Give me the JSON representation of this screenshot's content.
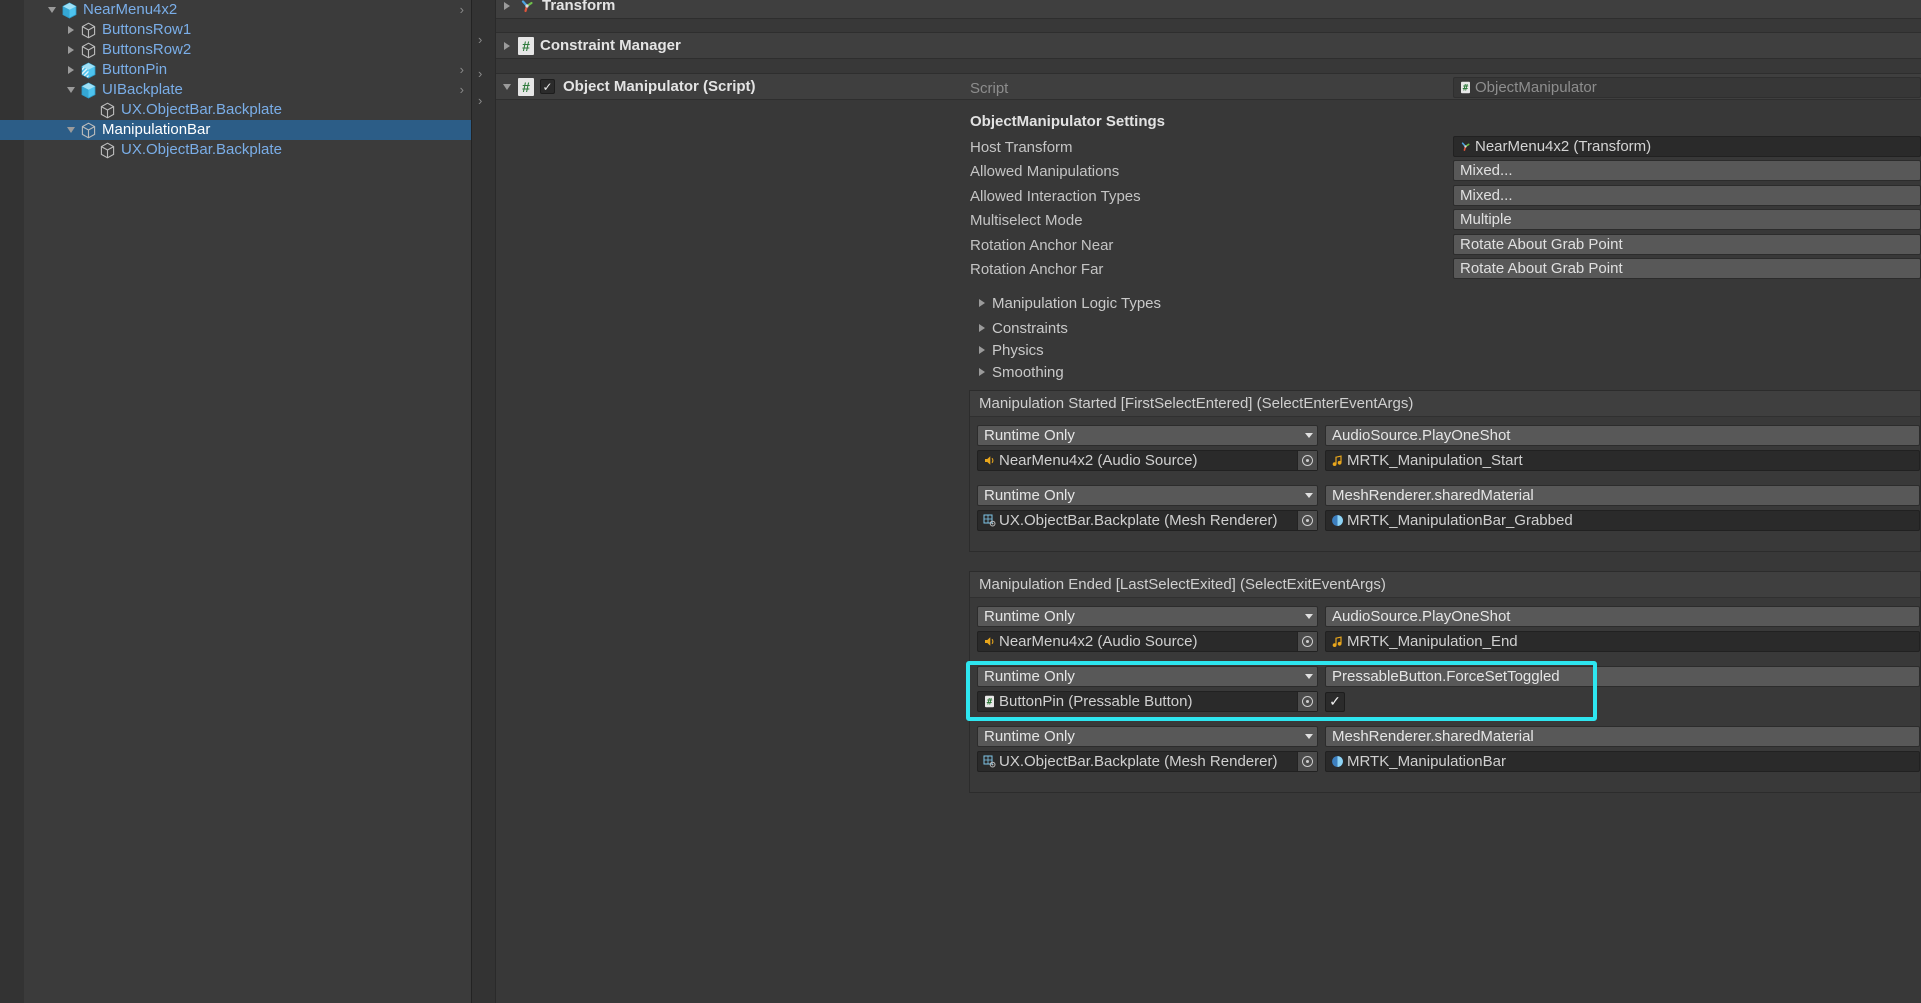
{
  "hierarchy": {
    "items": [
      {
        "label": "NearMenu4x2",
        "depth": 1,
        "expanded": "down",
        "icon": "prefab-cube-icon",
        "selected": false,
        "chevron": true
      },
      {
        "label": "ButtonsRow1",
        "depth": 2,
        "expanded": "right",
        "icon": "gameobject-cube-icon",
        "selected": false,
        "chevron": false
      },
      {
        "label": "ButtonsRow2",
        "depth": 2,
        "expanded": "right",
        "icon": "gameobject-cube-icon",
        "selected": false,
        "chevron": false
      },
      {
        "label": "ButtonPin",
        "depth": 2,
        "expanded": "right",
        "icon": "prefab-variant-cube-icon",
        "selected": false,
        "chevron": true
      },
      {
        "label": "UIBackplate",
        "depth": 2,
        "expanded": "down",
        "icon": "prefab-cube-icon",
        "selected": false,
        "chevron": true
      },
      {
        "label": "UX.ObjectBar.Backplate",
        "depth": 3,
        "expanded": "none",
        "icon": "gameobject-cube-icon",
        "selected": false,
        "chevron": false
      },
      {
        "label": "ManipulationBar",
        "depth": 2,
        "expanded": "down",
        "icon": "gameobject-cube-icon",
        "selected": true,
        "chevron": false
      },
      {
        "label": "UX.ObjectBar.Backplate",
        "depth": 3,
        "expanded": "none",
        "icon": "gameobject-cube-icon",
        "selected": false,
        "chevron": false
      }
    ]
  },
  "inspector": {
    "components": [
      {
        "name": "Transform",
        "icon": "transform-icon",
        "expanded": "right",
        "has_checkbox": false
      },
      {
        "name": "Constraint Manager",
        "icon": "script-icon",
        "expanded": "right",
        "has_checkbox": false
      },
      {
        "name": "Object Manipulator (Script)",
        "icon": "script-icon",
        "expanded": "down",
        "has_checkbox": true,
        "checked": true
      }
    ],
    "script_row": {
      "label": "Script",
      "value": "ObjectManipulator",
      "icon": "script-icon"
    },
    "section_header": "ObjectManipulator Settings",
    "fields": [
      {
        "label": "Host Transform",
        "value": "NearMenu4x2 (Transform)",
        "type": "object",
        "icon": "transform-icon"
      },
      {
        "label": "Allowed Manipulations",
        "value": "Mixed...",
        "type": "enum"
      },
      {
        "label": "Allowed Interaction Types",
        "value": "Mixed...",
        "type": "enum"
      },
      {
        "label": "Multiselect Mode",
        "value": "Multiple",
        "type": "enum"
      },
      {
        "label": "Rotation Anchor Near",
        "value": "Rotate About Grab Point",
        "type": "enum"
      },
      {
        "label": "Rotation Anchor Far",
        "value": "Rotate About Grab Point",
        "type": "enum"
      }
    ],
    "foldouts": [
      {
        "label": "Manipulation Logic Types"
      },
      {
        "label": "Constraints"
      },
      {
        "label": "Physics"
      },
      {
        "label": "Smoothing"
      }
    ],
    "events": [
      {
        "title": "Manipulation Started [FirstSelectEntered] (SelectEnterEventArgs)",
        "entries": [
          {
            "mode": "Runtime Only",
            "method": "AudioSource.PlayOneShot",
            "target": "NearMenu4x2 (Audio Source)",
            "target_icon": "audio-source-icon",
            "arg": "MRTK_Manipulation_Start",
            "arg_icon": "audio-clip-icon",
            "arg_type": "object",
            "highlighted": false
          },
          {
            "mode": "Runtime Only",
            "method": "MeshRenderer.sharedMaterial",
            "target": "UX.ObjectBar.Backplate (Mesh Renderer)",
            "target_icon": "mesh-renderer-icon",
            "arg": "MRTK_ManipulationBar_Grabbed",
            "arg_icon": "material-icon",
            "arg_type": "object",
            "highlighted": false
          }
        ]
      },
      {
        "title": "Manipulation Ended [LastSelectExited] (SelectExitEventArgs)",
        "entries": [
          {
            "mode": "Runtime Only",
            "method": "AudioSource.PlayOneShot",
            "target": "NearMenu4x2 (Audio Source)",
            "target_icon": "audio-source-icon",
            "arg": "MRTK_Manipulation_End",
            "arg_icon": "audio-clip-icon",
            "arg_type": "object",
            "highlighted": false
          },
          {
            "mode": "Runtime Only",
            "method": "PressableButton.ForceSetToggled",
            "target": "ButtonPin (Pressable Button)",
            "target_icon": "script-icon",
            "arg": "",
            "arg_icon": "",
            "arg_type": "bool",
            "arg_checked": true,
            "highlighted": true
          },
          {
            "mode": "Runtime Only",
            "method": "MeshRenderer.sharedMaterial",
            "target": "UX.ObjectBar.Backplate (Mesh Renderer)",
            "target_icon": "mesh-renderer-icon",
            "arg": "MRTK_ManipulationBar",
            "arg_icon": "material-icon",
            "arg_type": "object",
            "highlighted": false
          }
        ]
      }
    ]
  },
  "colors": {
    "selection_blue": "#2c5d87",
    "hierarchy_text": "#7aaee8",
    "highlight_cyan": "#2ee6f0",
    "panel_bg": "#383838"
  }
}
